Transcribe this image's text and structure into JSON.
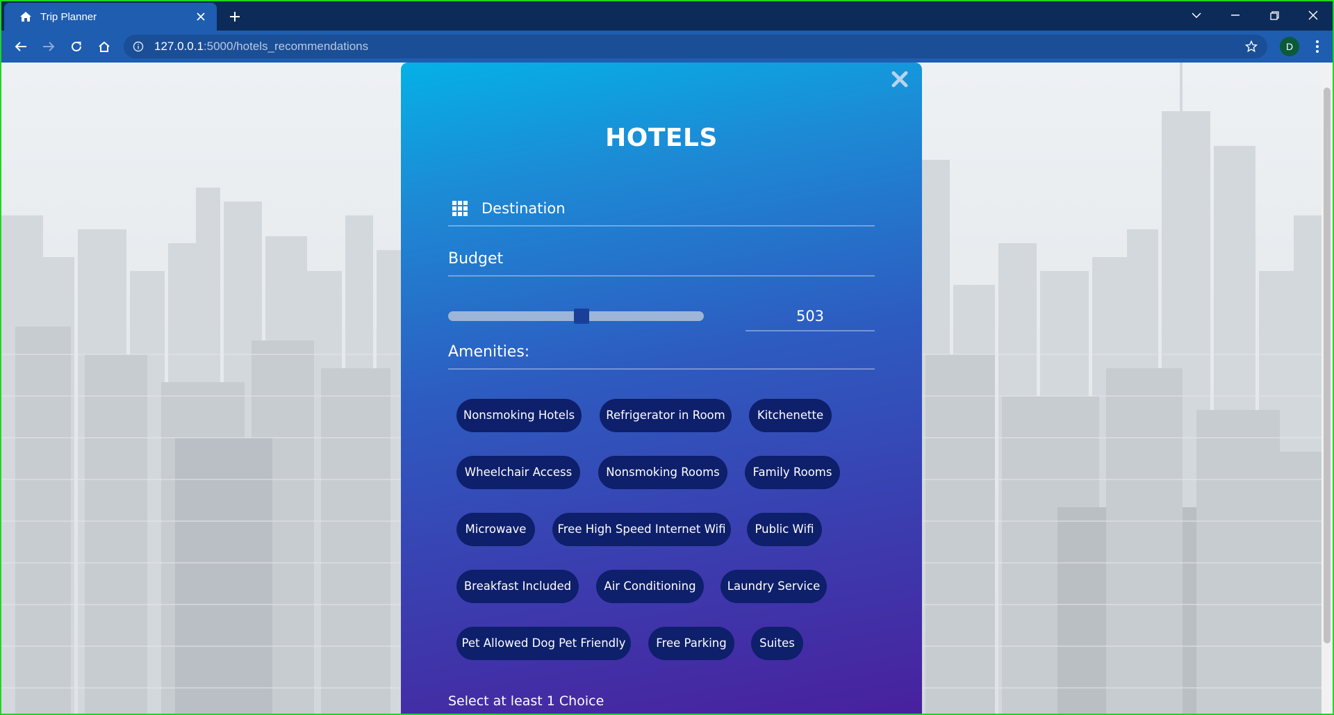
{
  "browser": {
    "tab_title": "Trip Planner",
    "url_host": "127.0.0.1",
    "url_rest": ":5000/hotels_recommendations",
    "profile_initial": "D"
  },
  "modal": {
    "title": "HOTELS",
    "destination_placeholder": "Destination",
    "budget_label": "Budget",
    "budget_value": "503",
    "budget_fraction": 0.5,
    "amenities_label": "Amenities:",
    "amenities": [
      [
        "Nonsmoking Hotels",
        "Refrigerator in Room",
        "Kitchenette"
      ],
      [
        "Wheelchair Access",
        "Nonsmoking Rooms",
        "Family Rooms"
      ],
      [
        "Microwave",
        "Free High Speed Internet Wifi",
        "Public Wifi"
      ],
      [
        "Breakfast Included",
        "Air Conditioning",
        "Laundry Service"
      ],
      [
        "Pet Allowed Dog Pet Friendly",
        "Free Parking",
        "Suites"
      ]
    ],
    "footer_note": "Select at least 1 Choice"
  }
}
